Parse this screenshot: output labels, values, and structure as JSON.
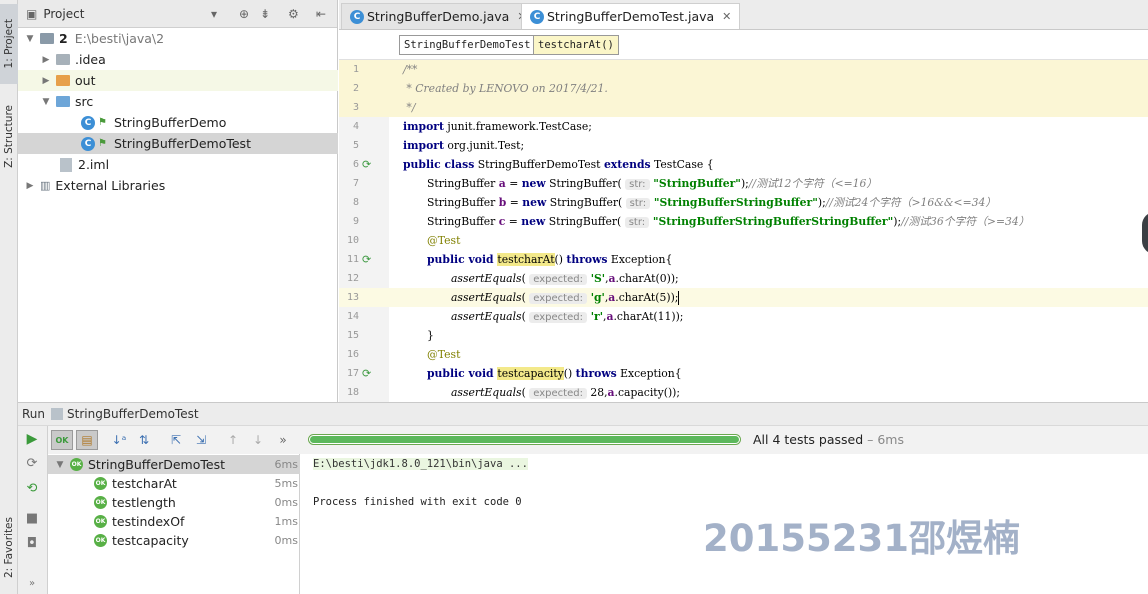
{
  "side_tabs": {
    "project": "1: Project",
    "structure": "Z: Structure",
    "favorites": "2: Favorites"
  },
  "project_panel": {
    "title": "Project",
    "tree": [
      {
        "label": "2",
        "path": "E:\\besti\\java\\2"
      },
      {
        "label": ".idea"
      },
      {
        "label": "out"
      },
      {
        "label": "src"
      },
      {
        "label": "StringBufferDemo"
      },
      {
        "label": "StringBufferDemoTest"
      },
      {
        "label": "2.iml"
      },
      {
        "label": "External Libraries"
      }
    ]
  },
  "editor": {
    "tabs": [
      {
        "label": "StringBufferDemo.java"
      },
      {
        "label": "StringBufferDemoTest.java"
      }
    ],
    "breadcrumb": {
      "class": "StringBufferDemoTest",
      "method": "testcharAt()"
    },
    "line_numbers": [
      "1",
      "2",
      "3",
      "4",
      "5",
      "6",
      "7",
      "8",
      "9",
      "10",
      "11",
      "12",
      "13",
      "14",
      "15",
      "16",
      "17",
      "18"
    ],
    "code": {
      "l1": "/**",
      "l2": " * Created by LENOVO on 2017/4/21.",
      "l3": " */",
      "l4_kw": "import",
      "l4": " junit.framework.TestCase;",
      "l5_kw": "import",
      "l5": " org.junit.Test;",
      "l6_kw1": "public class",
      "l6_a": " StringBufferDemoTest ",
      "l6_kw2": "extends",
      "l6_b": " TestCase {",
      "l7_type": "StringBuffer ",
      "l7_var": "a",
      "l7_eq": " = ",
      "l7_new": "new",
      "l7_ctor": " StringBuffer( ",
      "l7_hint": "str:",
      "l7_str": " \"StringBuffer\"",
      "l7_end": ");",
      "l7_cm": "//测试12个字符（<=16）",
      "l8_type": "StringBuffer ",
      "l8_var": "b",
      "l8_eq": " = ",
      "l8_new": "new",
      "l8_ctor": " StringBuffer( ",
      "l8_hint": "str:",
      "l8_str": " \"StringBufferStringBuffer\"",
      "l8_end": ");",
      "l8_cm": "//测试24个字符（>16&&<=34）",
      "l9_type": "StringBuffer ",
      "l9_var": "c",
      "l9_eq": " = ",
      "l9_new": "new",
      "l9_ctor": " StringBuffer( ",
      "l9_hint": "str:",
      "l9_str": " \"StringBufferStringBufferStringBuffer\"",
      "l9_end": ");",
      "l9_cm": "//测试36个字符（>=34）",
      "l10": "@Test",
      "l11_kw": "public void ",
      "l11_m": "testcharAt",
      "l11_a": "() ",
      "l11_kw2": "throws",
      "l11_b": " Exception{",
      "l12_f": "assertEquals",
      "l12_a": "( ",
      "l12_hint": "expected:",
      "l12_c": " 'S'",
      "l12_b": ",",
      "l12_v": "a",
      "l12_d": ".charAt(0));",
      "l13_f": "assertEquals",
      "l13_a": "( ",
      "l13_hint": "expected:",
      "l13_c": " 'g'",
      "l13_b": ",",
      "l13_v": "a",
      "l13_d": ".charAt(5));",
      "l14_f": "assertEquals",
      "l14_a": "( ",
      "l14_hint": "expected:",
      "l14_c": " 'r'",
      "l14_b": ",",
      "l14_v": "a",
      "l14_d": ".charAt(11));",
      "l15": "}",
      "l16": "@Test",
      "l17_kw": "public void ",
      "l17_m": "testcapacity",
      "l17_a": "() ",
      "l17_kw2": "throws",
      "l17_b": " Exception{",
      "l18_f": "assertEquals",
      "l18_a": "( ",
      "l18_hint": "expected:",
      "l18_c": " 28,",
      "l18_v": "a",
      "l18_d": ".capacity());"
    }
  },
  "run_panel": {
    "label": "Run",
    "config": "StringBufferDemoTest",
    "status": "All 4 tests passed",
    "status_time": "– 6ms",
    "progress": 1.0,
    "tests": [
      {
        "name": "StringBufferDemoTest",
        "time": "6ms"
      },
      {
        "name": "testcharAt",
        "time": "5ms"
      },
      {
        "name": "testlength",
        "time": "0ms"
      },
      {
        "name": "testindexOf",
        "time": "1ms"
      },
      {
        "name": "testcapacity",
        "time": "0ms"
      }
    ],
    "console": {
      "command": "E:\\besti\\jdk1.8.0_121\\bin\\java ...",
      "exit": "Process finished with exit code 0",
      "watermark": "20155231邵煜楠"
    }
  },
  "colors": {
    "keyword": "#000080",
    "string": "#008000",
    "pass_green": "#58b046",
    "accent_blue": "#3c8fd6"
  }
}
